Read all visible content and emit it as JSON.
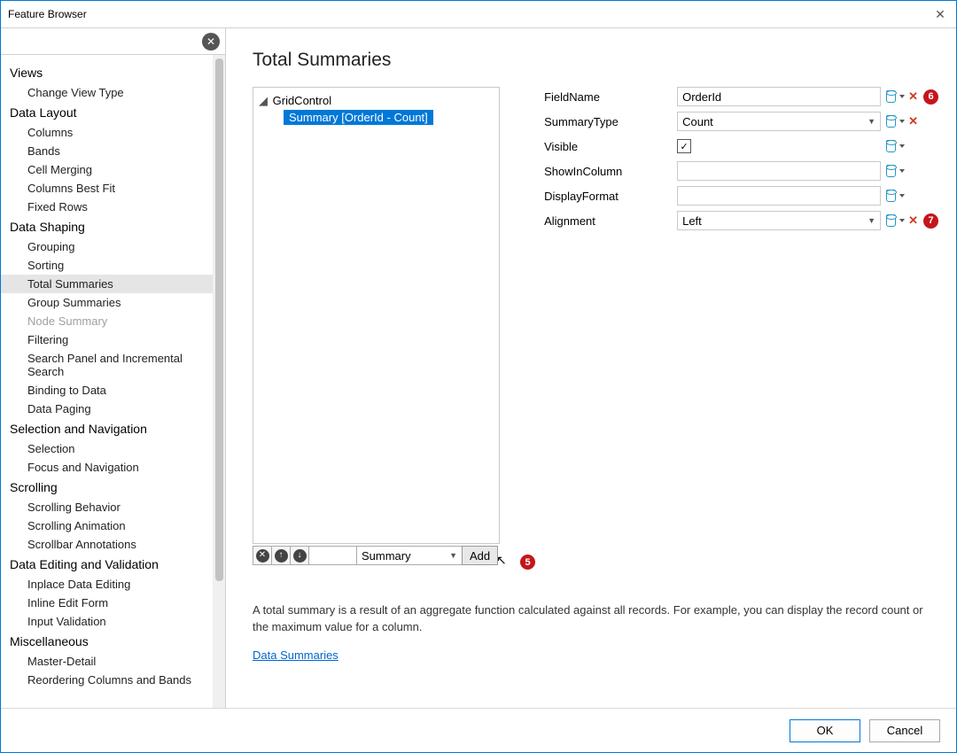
{
  "window": {
    "title": "Feature Browser"
  },
  "sidebar": {
    "search": {
      "value": ""
    },
    "groups": [
      {
        "label": "Views",
        "items": [
          {
            "label": "Change View Type"
          }
        ]
      },
      {
        "label": "Data Layout",
        "items": [
          {
            "label": "Columns"
          },
          {
            "label": "Bands"
          },
          {
            "label": "Cell Merging"
          },
          {
            "label": "Columns Best Fit"
          },
          {
            "label": "Fixed Rows"
          }
        ]
      },
      {
        "label": "Data Shaping",
        "items": [
          {
            "label": "Grouping"
          },
          {
            "label": "Sorting"
          },
          {
            "label": "Total Summaries",
            "selected": true
          },
          {
            "label": "Group Summaries"
          },
          {
            "label": "Node Summary",
            "disabled": true
          },
          {
            "label": "Filtering"
          },
          {
            "label": "Search Panel and Incremental Search"
          },
          {
            "label": "Binding to Data"
          },
          {
            "label": "Data Paging"
          }
        ]
      },
      {
        "label": "Selection and Navigation",
        "items": [
          {
            "label": "Selection"
          },
          {
            "label": "Focus and Navigation"
          }
        ]
      },
      {
        "label": "Scrolling",
        "items": [
          {
            "label": "Scrolling Behavior"
          },
          {
            "label": "Scrolling Animation"
          },
          {
            "label": "Scrollbar Annotations"
          }
        ]
      },
      {
        "label": "Data Editing and Validation",
        "items": [
          {
            "label": "Inplace Data Editing"
          },
          {
            "label": "Inline Edit Form"
          },
          {
            "label": "Input Validation"
          }
        ]
      },
      {
        "label": "Miscellaneous",
        "items": [
          {
            "label": "Master-Detail"
          },
          {
            "label": "Reordering Columns and Bands"
          }
        ]
      }
    ]
  },
  "page": {
    "title": "Total Summaries",
    "tree": {
      "root": "GridControl",
      "child": "Summary [OrderId - Count]"
    },
    "toolbar": {
      "select": "Summary",
      "add": "Add"
    },
    "props": {
      "FieldName": {
        "label": "FieldName",
        "value": "OrderId",
        "hasX": true,
        "badge": "6"
      },
      "SummaryType": {
        "label": "SummaryType",
        "value": "Count",
        "hasX": true,
        "badge": ""
      },
      "Visible": {
        "label": "Visible",
        "checked": true
      },
      "ShowInColumn": {
        "label": "ShowInColumn",
        "value": ""
      },
      "DisplayFormat": {
        "label": "DisplayFormat",
        "value": ""
      },
      "Alignment": {
        "label": "Alignment",
        "value": "Left",
        "hasX": true,
        "badge": "7"
      }
    },
    "badges": {
      "add": "5"
    },
    "description": "A total summary is a result of an aggregate function calculated against all records. For example, you can display the record count or the maximum value for a column.",
    "link": "Data Summaries"
  },
  "footer": {
    "ok": "OK",
    "cancel": "Cancel"
  }
}
